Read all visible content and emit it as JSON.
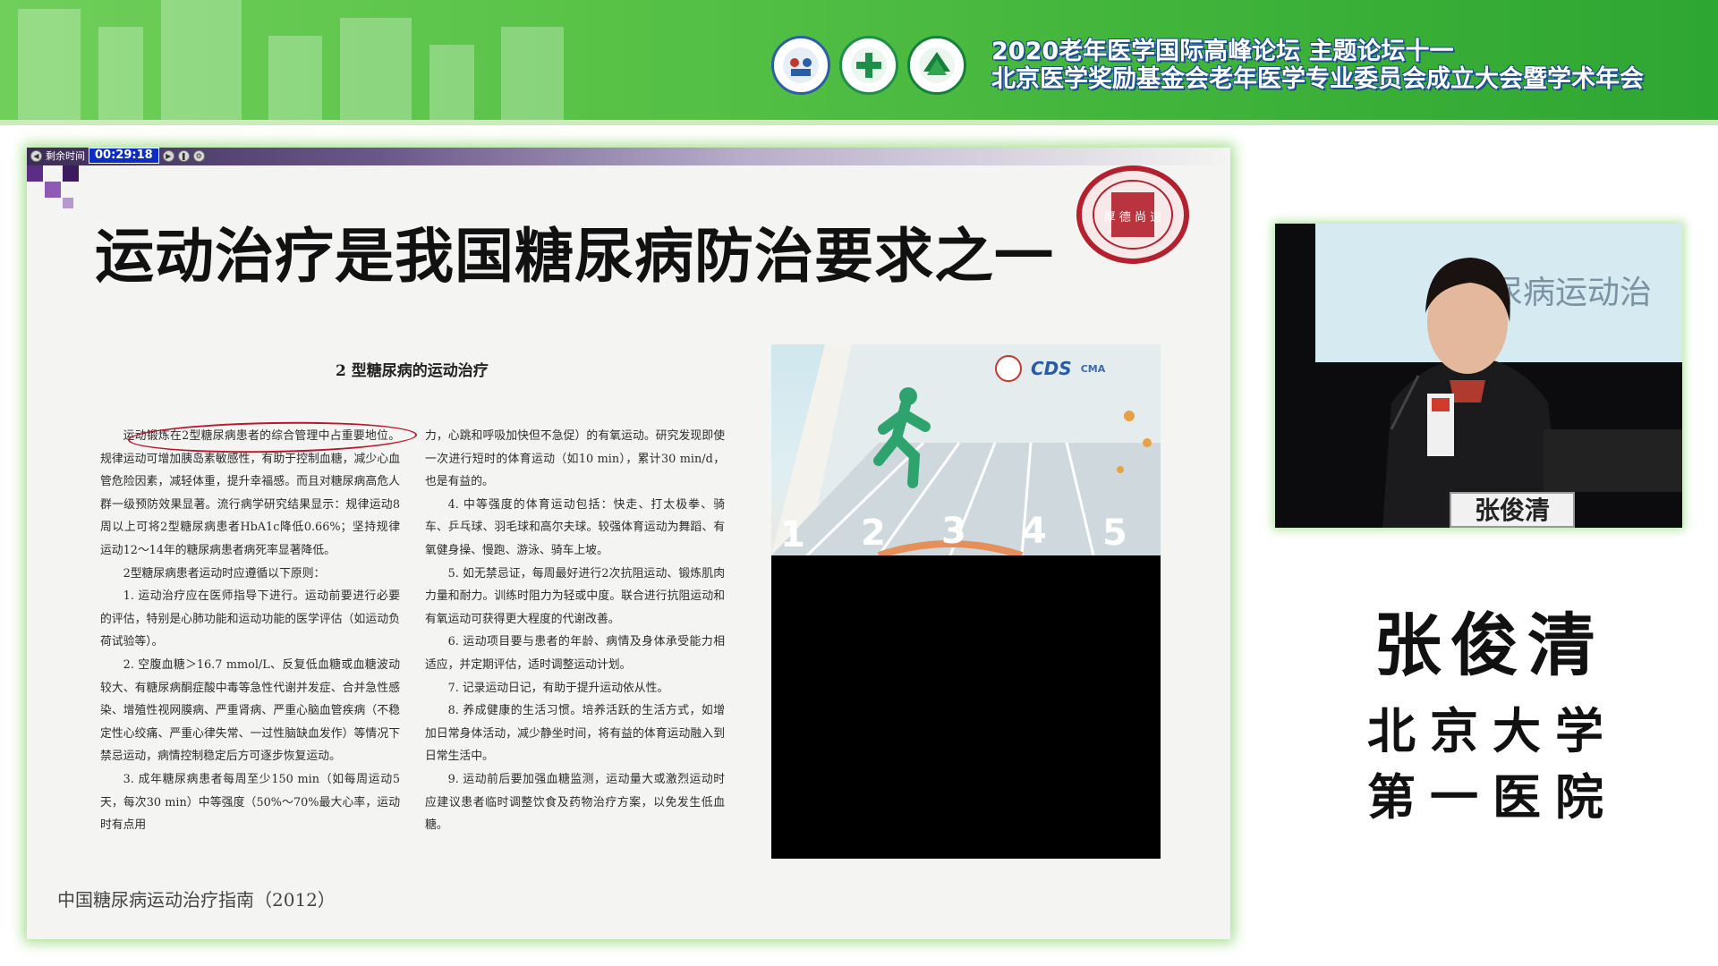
{
  "banner": {
    "title_line1": "2020老年医学国际高峰论坛 主题论坛十一",
    "title_line2": "北京医学奖励基金会老年医学专业委员会成立大会暨学术年会"
  },
  "slide": {
    "timer": {
      "label": "剩余时间",
      "value": "00:29:18"
    },
    "title": "运动治疗是我国糖尿病防治要求之一",
    "seal_text": "厚 德 尚 道",
    "paper": {
      "heading": "2 型糖尿病的运动治疗",
      "col1": [
        "运动锻炼在2型糖尿病患者的综合管理中占重要地位。规律运动可增加胰岛素敏感性，有助于控制血糖，减少心血管危险因素，减轻体重，提升幸福感。而且对糖尿病高危人群一级预防效果显著。流行病学研究结果显示：规律运动8周以上可将2型糖尿病患者HbA1c降低0.66%；坚持规律运动12～14年的糖尿病患者病死率显著降低。",
        "2型糖尿病患者运动时应遵循以下原则：",
        "1. 运动治疗应在医师指导下进行。运动前要进行必要的评估，特别是心肺功能和运动功能的医学评估（如运动负荷试验等）。",
        "2. 空腹血糖＞16.7 mmol/L、反复低血糖或血糖波动较大、有糖尿病酮症酸中毒等急性代谢并发症、合并急性感染、增殖性视网膜病、严重肾病、严重心脑血管疾病（不稳定性心绞痛、严重心律失常、一过性脑缺血发作）等情况下禁忌运动，病情控制稳定后方可逐步恢复运动。",
        "3. 成年糖尿病患者每周至少150 min（如每周运动5天，每次30 min）中等强度（50%～70%最大心率，运动时有点用"
      ],
      "col2": [
        "力，心跳和呼吸加快但不急促）的有氧运动。研究发现即使一次进行短时的体育运动（如10 min），累计30 min/d，也是有益的。",
        "4. 中等强度的体育运动包括：快走、打太极拳、骑车、乒乓球、羽毛球和高尔夫球。较强体育运动为舞蹈、有氧健身操、慢跑、游泳、骑车上坡。",
        "5. 如无禁忌证，每周最好进行2次抗阻运动、锻炼肌肉力量和耐力。训练时阻力为轻或中度。联合进行抗阻运动和有氧运动可获得更大程度的代谢改善。",
        "6. 运动项目要与患者的年龄、病情及身体承受能力相适应，并定期评估，适时调整运动计划。",
        "7. 记录运动日记，有助于提升运动依从性。",
        "8. 养成健康的生活习惯。培养活跃的生活方式，如增加日常身体活动，减少静坐时间，将有益的体育运动融入到日常生活中。",
        "9. 运动前后要加强血糖监测，运动量大或激烈运动时应建议患者临时调整饮食及药物治疗方案，以免发生低血糖。"
      ]
    },
    "source": "中国糖尿病运动治疗指南（2012）",
    "video": {
      "logo_cds": "CDS",
      "logo_cma": "CMA",
      "lanes": [
        "1",
        "2",
        "3",
        "4",
        "5"
      ]
    }
  },
  "camera": {
    "screen_text": "糖尿病运动治",
    "nameplate": "张俊清"
  },
  "speaker": {
    "name": "张俊清",
    "org_line1": "北京大学",
    "org_line2": "第一医院"
  },
  "colors": {
    "banner_green": "#4fbe42",
    "title_outline": "#1d4e8f",
    "annotation_red": "#c0142c",
    "timer_blue": "#0d2cc4",
    "seal_red": "#b3202e"
  }
}
